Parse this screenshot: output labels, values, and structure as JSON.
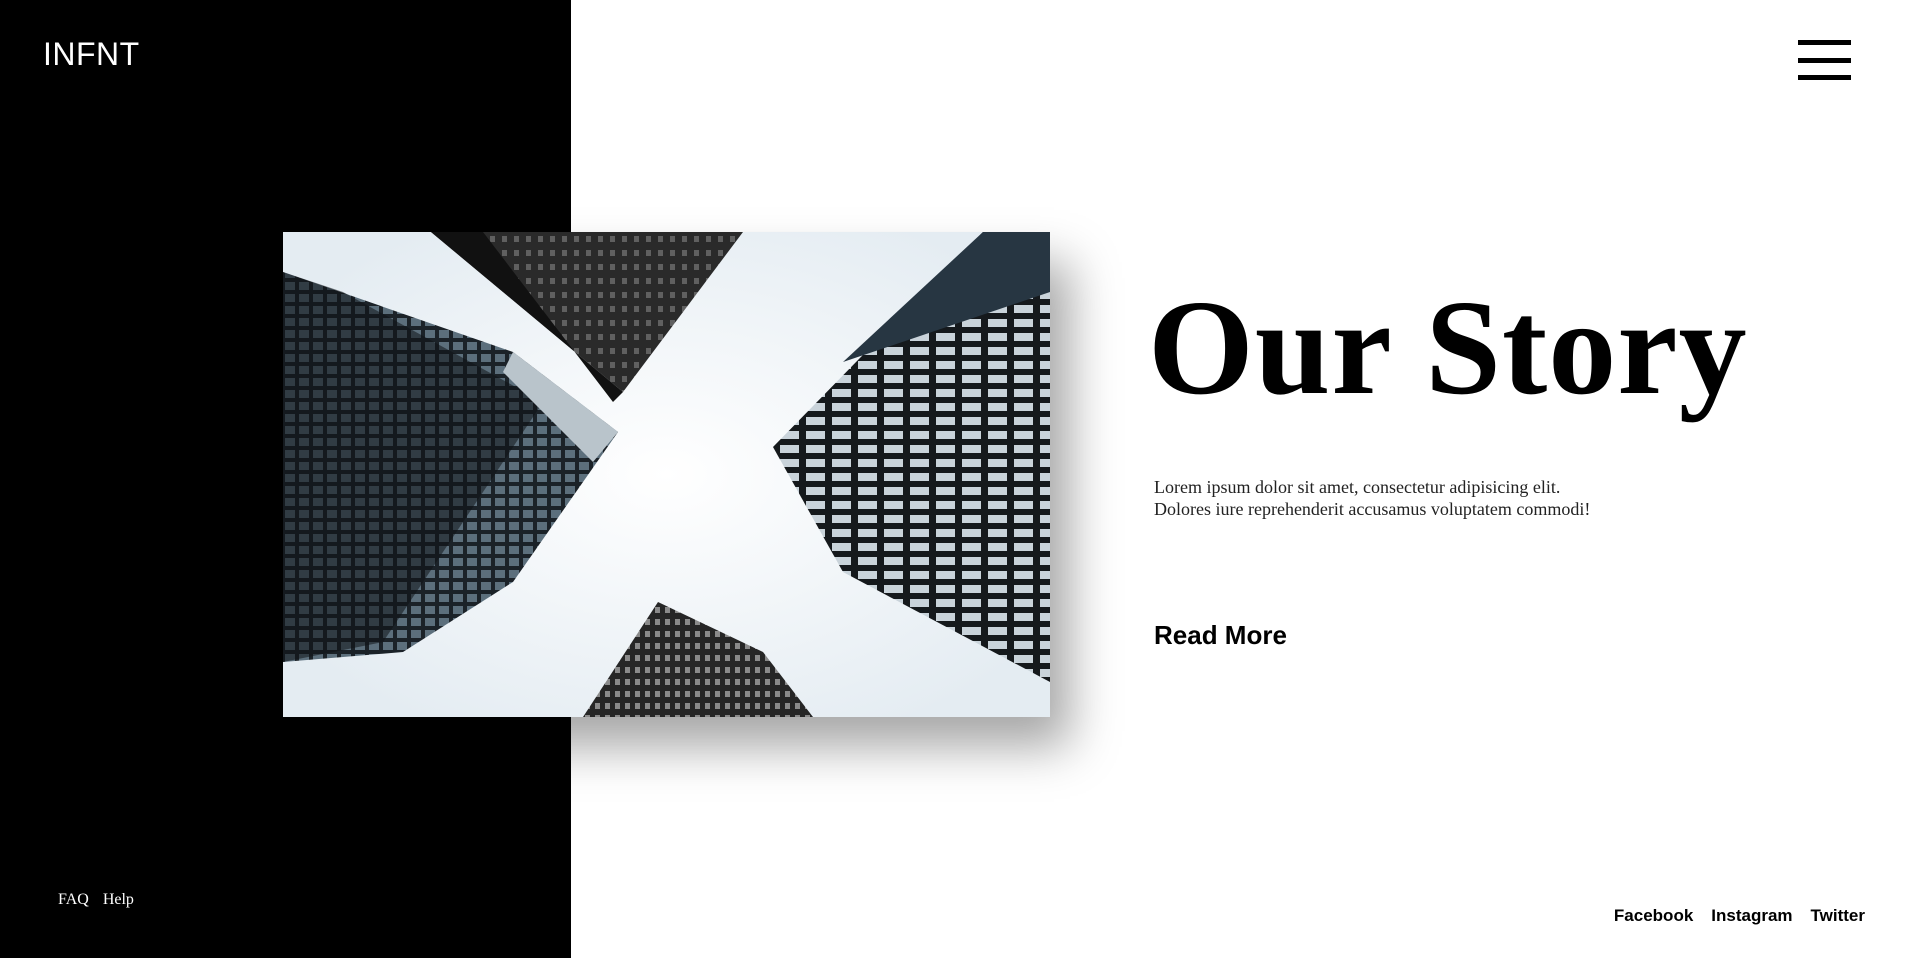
{
  "header": {
    "logo": "INFNT",
    "menu_icon": "hamburger-menu-icon"
  },
  "hero": {
    "image_subject": "looking-up-skyscrapers-photo"
  },
  "story": {
    "title": "Our Story",
    "body": "Lorem ipsum dolor sit amet, consectetur adipisicing elit. Dolores iure reprehenderit accusamus voluptatem commodi!",
    "cta": "Read More"
  },
  "left_footer": {
    "links": [
      "FAQ",
      "Help"
    ]
  },
  "social": {
    "links": [
      "Facebook",
      "Instagram",
      "Twitter"
    ]
  },
  "colors": {
    "panel": "#000000",
    "background": "#ffffff",
    "text": "#000000"
  }
}
